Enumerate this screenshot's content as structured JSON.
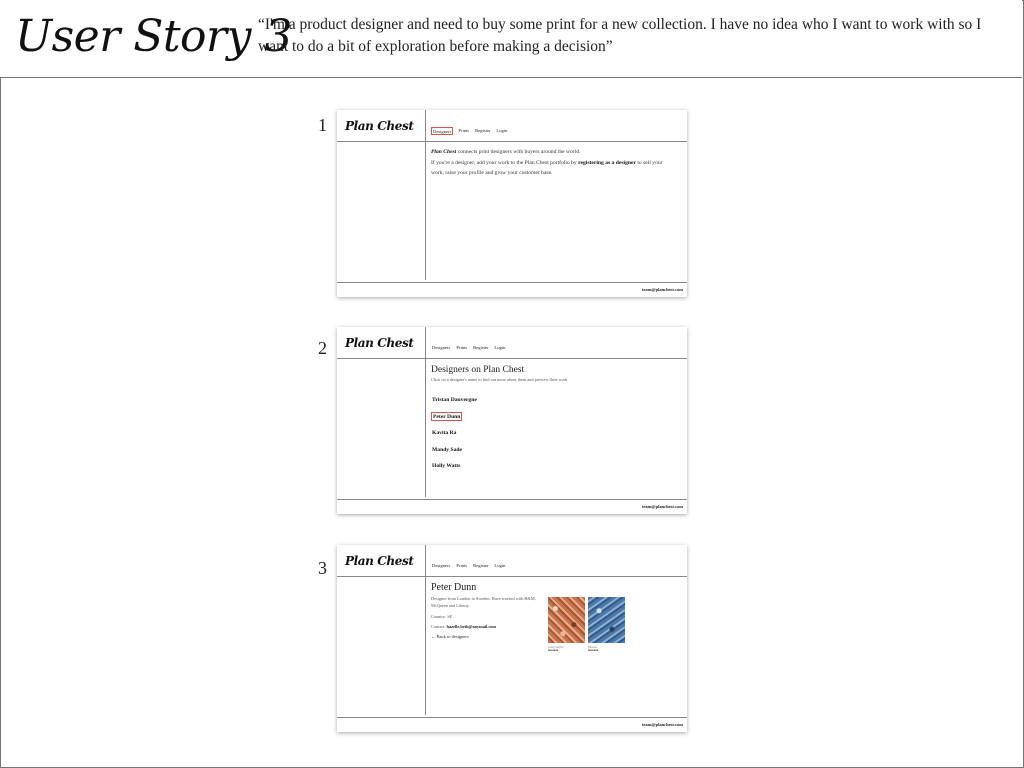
{
  "header": {
    "title": "User Story 3",
    "quote": "“I'm a product designer and need to buy some print for a new collection. I have no idea who I want to work with so I want to do a bit of exploration before making a decision”"
  },
  "steps": {
    "one": {
      "number": "1",
      "logo": "Plan Chest",
      "nav": [
        "Designers",
        "Prints",
        "Register",
        "Login"
      ],
      "highlighted_nav": "Designers",
      "intro_brand": "Plan Chest",
      "intro_1": " connects print designers with buyers around the world.",
      "intro_2": "If you're a designer, add your work to the Plan Chest portfolio by ",
      "intro_bold": "registering as a designer",
      "intro_3": " to sell your work, raise your profile and grow your customer base.",
      "footer_email": "team@planchest.com"
    },
    "two": {
      "number": "2",
      "logo": "Plan Chest",
      "nav": [
        "Designers",
        "Prints",
        "Register",
        "Login"
      ],
      "heading": "Designers on Plan Chest",
      "subheading": "Click on a designer's name to find out more about them and preview their work",
      "designers": [
        "Tristan Dauvergne",
        "Peter Dunn",
        "Kavita Ra",
        "Mandy Sade",
        "Holly Watts"
      ],
      "highlighted_designer": "Peter Dunn",
      "footer_email": "team@planchest.com"
    },
    "three": {
      "number": "3",
      "logo": "Plan Chest",
      "nav": [
        "Designers",
        "Prints",
        "Register",
        "Login"
      ],
      "name": "Peter Dunn",
      "bio": "Designer from London in Sweden. Have worked with H&M, McQueen and Liberty.",
      "country": "Country: SE",
      "contact_label": "Contact: ",
      "contact_value": "hazelle.beth@anymail.com",
      "back_link": "← Back to designers",
      "prints": [
        {
          "label": "Swing Sunbird",
          "sub": "See more",
          "color": "#c8734e"
        },
        {
          "label": "Bluerose",
          "sub": "See more",
          "color": "#4a78a8"
        }
      ],
      "footer_email": "team@planchest.com"
    }
  }
}
